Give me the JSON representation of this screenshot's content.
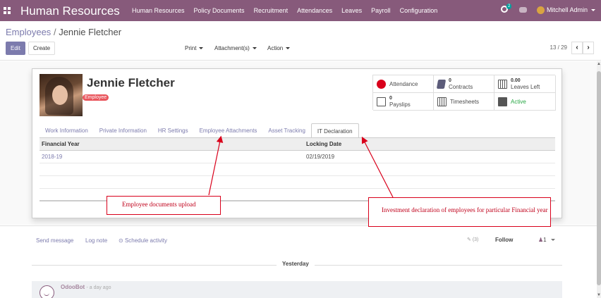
{
  "navbar": {
    "brand": "Human Resources",
    "menu": [
      "Human Resources",
      "Policy Documents",
      "Recruitment",
      "Attendances",
      "Leaves",
      "Payroll",
      "Configuration"
    ],
    "notification_count": "2",
    "user_name": "Mitchell Admin"
  },
  "breadcrumb": {
    "parent": "Employees",
    "separator": "/",
    "current": "Jennie Fletcher"
  },
  "actions": {
    "edit": "Edit",
    "create": "Create",
    "print": "Print",
    "attachments": "Attachment(s)",
    "action": "Action"
  },
  "pager": {
    "value": "13 / 29",
    "prev": "‹",
    "next": "›"
  },
  "employee": {
    "name": "Jennie Fletcher",
    "tag": "Employee"
  },
  "stat_buttons": {
    "attendance": "Attendance",
    "contracts_count": "0",
    "contracts_label": "Contracts",
    "leaves_count": "0.00",
    "leaves_label": "Leaves Left",
    "payslips_count": "0",
    "payslips_label": "Payslips",
    "timesheets": "Timesheets",
    "active": "Active"
  },
  "tabs": [
    "Work Information",
    "Private Information",
    "HR Settings",
    "Employee Attachments",
    "Asset Tracking",
    "IT Declaration"
  ],
  "active_tab": "IT Declaration",
  "table": {
    "columns": [
      "Financial Year",
      "Locking Date"
    ],
    "rows": [
      [
        "2018-19",
        "02/19/2019"
      ]
    ]
  },
  "annotations": {
    "left": "Employee documents upload",
    "right": "Investment declaration of employees for particular Financial year"
  },
  "chatter": {
    "send_message": "Send message",
    "log_note": "Log note",
    "schedule_activity": "Schedule activity",
    "attachments_count": "(3)",
    "follow": "Follow",
    "followers": "1",
    "date_divider": "Yesterday",
    "message_author": "OdooBot",
    "message_time": "- a day ago"
  },
  "colors": {
    "navbar": "#875a7b",
    "link": "#7c7bad",
    "tag": "#e9565d",
    "annotation": "#d9001b",
    "active": "#28a745"
  }
}
